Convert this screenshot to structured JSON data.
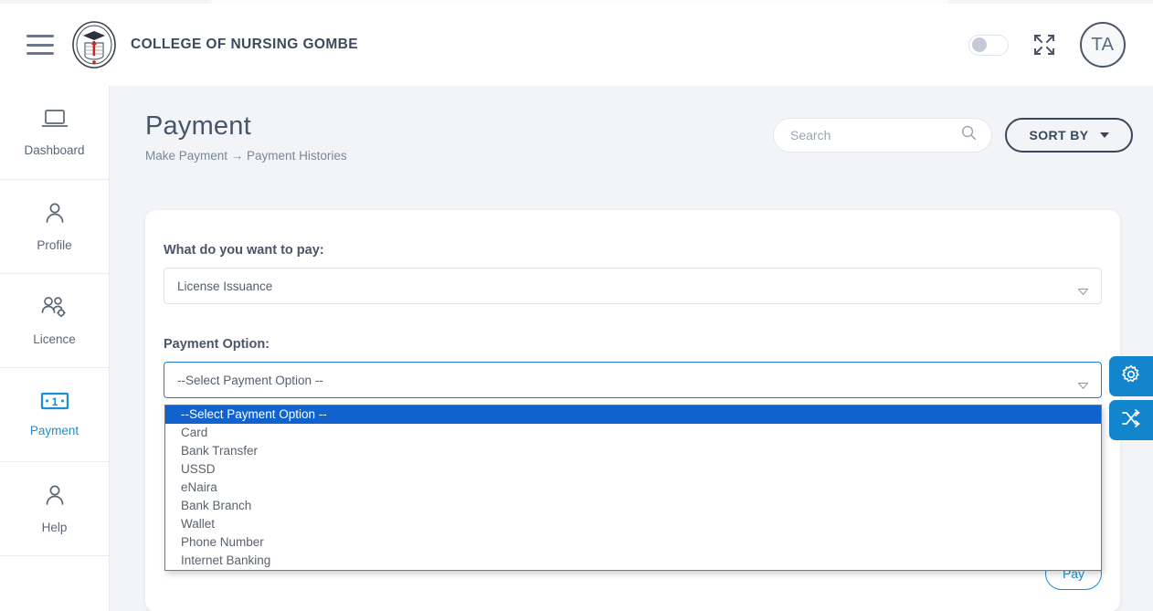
{
  "header": {
    "menu_icon": "hamburger-icon",
    "logo_icon": "college-seal-logo",
    "brand_title": "COLLEGE OF NURSING GOMBE",
    "theme_toggle": "theme-toggle",
    "expand_icon": "fullscreen-expand-icon",
    "avatar_initials": "TA"
  },
  "sidebar": {
    "items": [
      {
        "label": "Dashboard",
        "icon": "laptop-icon",
        "active": false
      },
      {
        "label": "Profile",
        "icon": "user-icon",
        "active": false
      },
      {
        "label": "Licence",
        "icon": "users-gear-icon",
        "active": false
      },
      {
        "label": "Payment",
        "icon": "banknote-icon",
        "active": true
      },
      {
        "label": "Help",
        "icon": "user-icon",
        "active": false
      }
    ],
    "active_color": "#1a8fd4"
  },
  "page": {
    "title": "Payment",
    "breadcrumb": "Make Payment → Payment Histories"
  },
  "search": {
    "placeholder": "Search",
    "value": "",
    "icon": "search-icon"
  },
  "sort": {
    "label": "SORT BY",
    "icon": "chevron-down-icon"
  },
  "form": {
    "pay_for": {
      "label": "What do you want to pay:",
      "value": "License Issuance"
    },
    "payment_option": {
      "label": "Payment Option:",
      "value": "--Select Payment Option --",
      "options": [
        "--Select Payment Option --",
        "Card",
        "Bank Transfer",
        "USSD",
        "eNaira",
        "Bank Branch",
        "Wallet",
        "Phone Number",
        "Internet Banking"
      ],
      "selected_index": 0,
      "highlight_color": "#1063cf"
    },
    "pay_button": "Pay"
  },
  "floating_buttons": [
    {
      "icon": "gear-icon",
      "color": "#1285cd"
    },
    {
      "icon": "shuffle-icon",
      "color": "#1285cd"
    }
  ]
}
